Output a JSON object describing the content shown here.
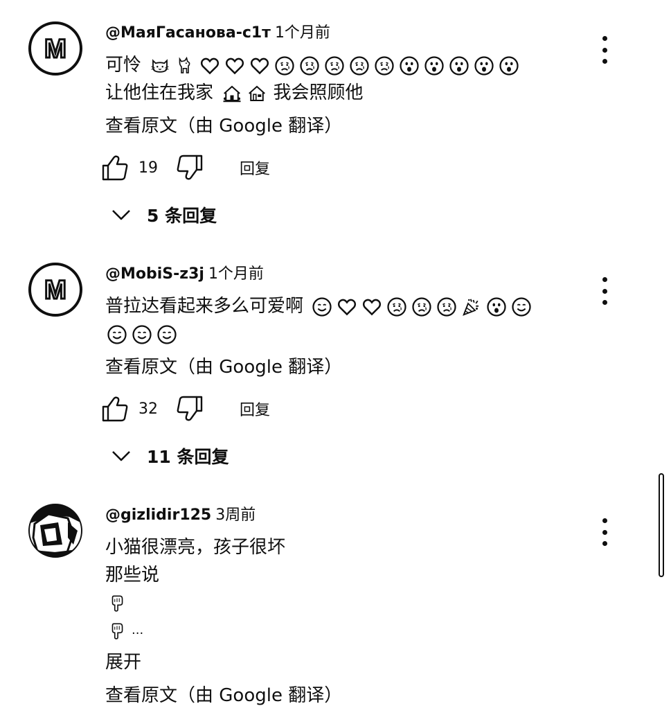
{
  "comments": [
    {
      "author": "@МаяГасанова-с1т",
      "time": "1个月前",
      "avatar_letter": "M",
      "text_line1_prefix": "可怜",
      "text_line1_emojis": [
        "cat-face",
        "dog",
        "heart",
        "heart",
        "heart",
        "sad-face",
        "sad-face",
        "sad-face",
        "sad-face",
        "sad-face",
        "surprised-face",
        "surprised-face",
        "surprised-face",
        "surprised-face",
        "surprised-face"
      ],
      "text_line2_prefix": "让他住在我家",
      "text_line2_emojis": [
        "house-with-garden",
        "house"
      ],
      "text_line2_suffix": "我会照顾他",
      "translate_label": "查看原文（由 Google 翻译）",
      "likes": "19",
      "reply_label": "回复",
      "replies_label": "5 条回复"
    },
    {
      "author": "@MobiS-z3j",
      "time": "1个月前",
      "avatar_letter": "M",
      "text_line1_prefix": "普拉达看起来多么可爱啊",
      "text_line1_emojis": [
        "smiling-face",
        "heart",
        "heart",
        "sad-face",
        "sad-face",
        "sad-face",
        "party-popper",
        "surprised-face",
        "smiling-face"
      ],
      "text_line2_emojis": [
        "smiling-face",
        "smiling-face",
        "smiling-face"
      ],
      "translate_label": "查看原文（由 Google 翻译）",
      "likes": "32",
      "reply_label": "回复",
      "replies_label": "11 条回复"
    },
    {
      "author": "@gizlidir125",
      "time": "3周前",
      "text_line1": "小猫很漂亮，孩子很坏",
      "text_line2": "那些说",
      "text_line3_emoji": "pointing-down-hand",
      "text_line4_emoji": "pointing-down-hand",
      "text_line4_suffix": "...",
      "expand_label": "展开",
      "translate_label": "查看原文（由 Google 翻译）"
    }
  ],
  "colors": {
    "text": "#0f0f0f",
    "background": "#ffffff"
  },
  "icons": {
    "like": "thumbs-up-icon",
    "dislike": "thumbs-down-icon",
    "expand": "chevron-down-icon",
    "menu": "more-vert-icon"
  }
}
